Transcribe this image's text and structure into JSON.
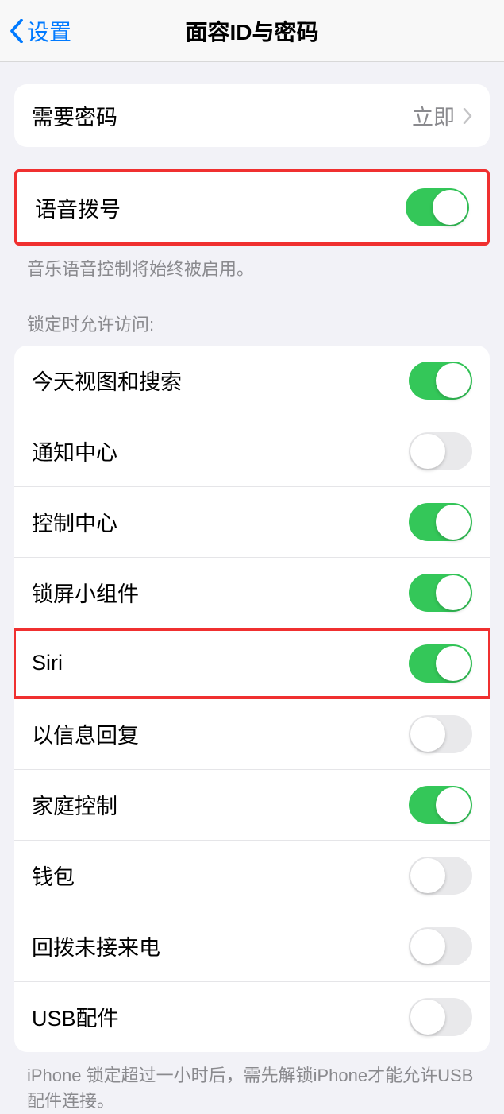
{
  "header": {
    "back_label": "设置",
    "title": "面容ID与密码"
  },
  "require_passcode": {
    "label": "需要密码",
    "value": "立即"
  },
  "voice_dial": {
    "label": "语音拨号",
    "on": true,
    "footer": "音乐语音控制将始终被启用。"
  },
  "locked_group_header": "锁定时允许访问:",
  "locked_items": [
    {
      "label": "今天视图和搜索",
      "on": true
    },
    {
      "label": "通知中心",
      "on": false
    },
    {
      "label": "控制中心",
      "on": true
    },
    {
      "label": "锁屏小组件",
      "on": true
    },
    {
      "label": "Siri",
      "on": true,
      "highlight": true
    },
    {
      "label": "以信息回复",
      "on": false
    },
    {
      "label": "家庭控制",
      "on": true
    },
    {
      "label": "钱包",
      "on": false
    },
    {
      "label": "回拨未接来电",
      "on": false
    },
    {
      "label": "USB配件",
      "on": false
    }
  ],
  "usb_footer": "iPhone 锁定超过一小时后，需先解锁iPhone才能允许USB 配件连接。"
}
